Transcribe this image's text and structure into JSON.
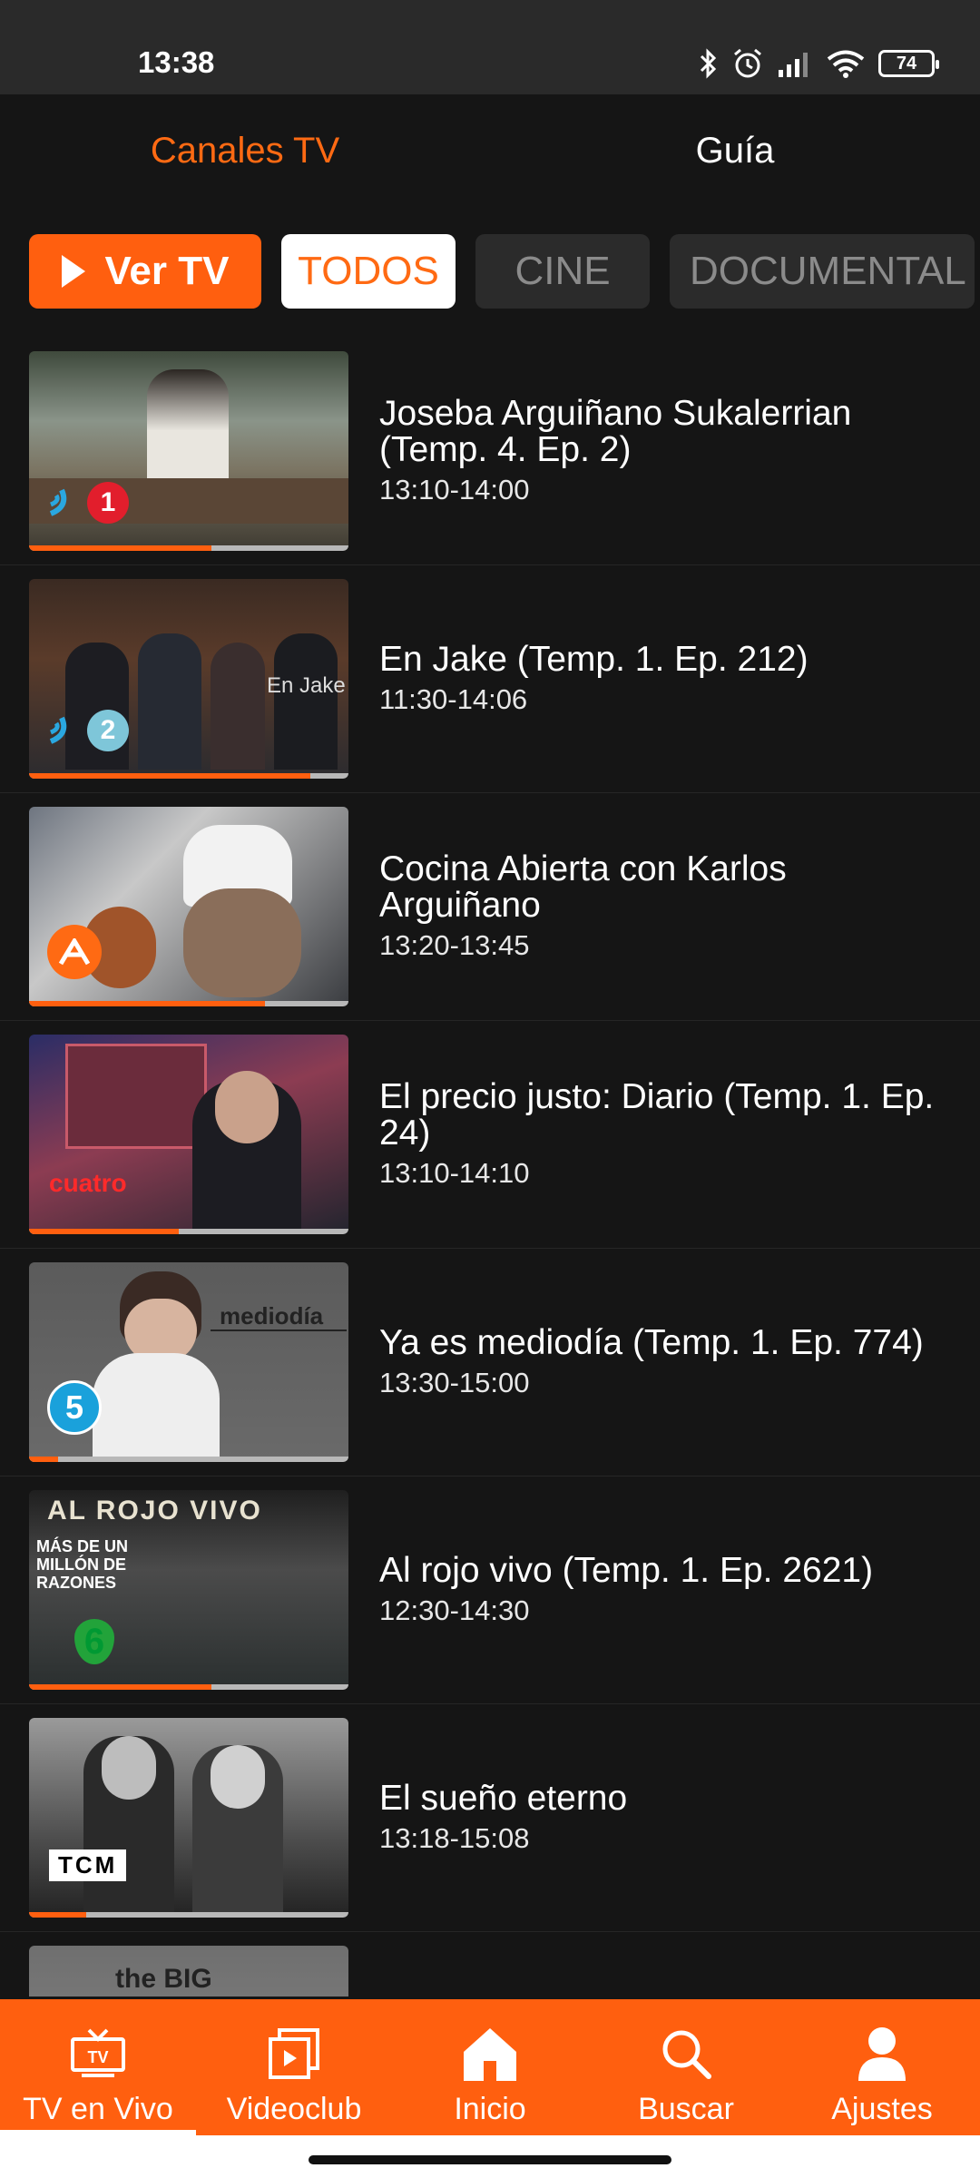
{
  "status": {
    "time": "13:38",
    "battery": "74"
  },
  "tabs": {
    "live": "Canales TV",
    "guide": "Guía"
  },
  "filters": {
    "watch": "Ver TV",
    "items": [
      "TODOS",
      "CINE",
      "DOCUMENTAL"
    ]
  },
  "channels": [
    {
      "title": "Joseba Arguiñano Sukalerrian (Temp. 4. Ep. 2)",
      "time": "13:10-14:00",
      "channel": "ETB 1",
      "progress": 0.57
    },
    {
      "title": "En Jake (Temp. 1. Ep. 212)",
      "time": "11:30-14:06",
      "channel": "ETB 2",
      "progress": 0.88
    },
    {
      "title": "Cocina Abierta con Karlos Arguiñano",
      "time": "13:20-13:45",
      "channel": "Antena 3",
      "progress": 0.74
    },
    {
      "title": "El precio justo: Diario (Temp. 1. Ep. 24)",
      "time": "13:10-14:10",
      "channel": "cuatro",
      "progress": 0.47
    },
    {
      "title": "Ya es mediodía (Temp. 1. Ep. 774)",
      "time": "13:30-15:00",
      "channel": "Telecinco",
      "progress": 0.09
    },
    {
      "title": "Al rojo vivo (Temp. 1. Ep. 2621)",
      "time": "12:30-14:30",
      "channel": "laSexta",
      "progress": 0.57
    },
    {
      "title": "El sueño eterno",
      "time": "13:18-15:08",
      "channel": "TCM",
      "progress": 0.18
    }
  ],
  "thumbs": {
    "enjake_text": "En Jake",
    "mediodia_text": "mediodía",
    "rojo_text": "AL ROJO VIVO",
    "razones_text": "MÁS DE UN MILLÓN DE RAZONES",
    "cuatro_text": "cuatro",
    "tcm_text": "TCM",
    "next_text": "the BIG"
  },
  "nav": [
    {
      "label": "TV en Vivo",
      "icon": "tv-icon"
    },
    {
      "label": "Videoclub",
      "icon": "videoclub-icon"
    },
    {
      "label": "Inicio",
      "icon": "home-icon"
    },
    {
      "label": "Buscar",
      "icon": "search-icon"
    },
    {
      "label": "Ajustes",
      "icon": "person-icon"
    }
  ],
  "colors": {
    "accent": "#ff5f0f",
    "background": "#151515"
  }
}
